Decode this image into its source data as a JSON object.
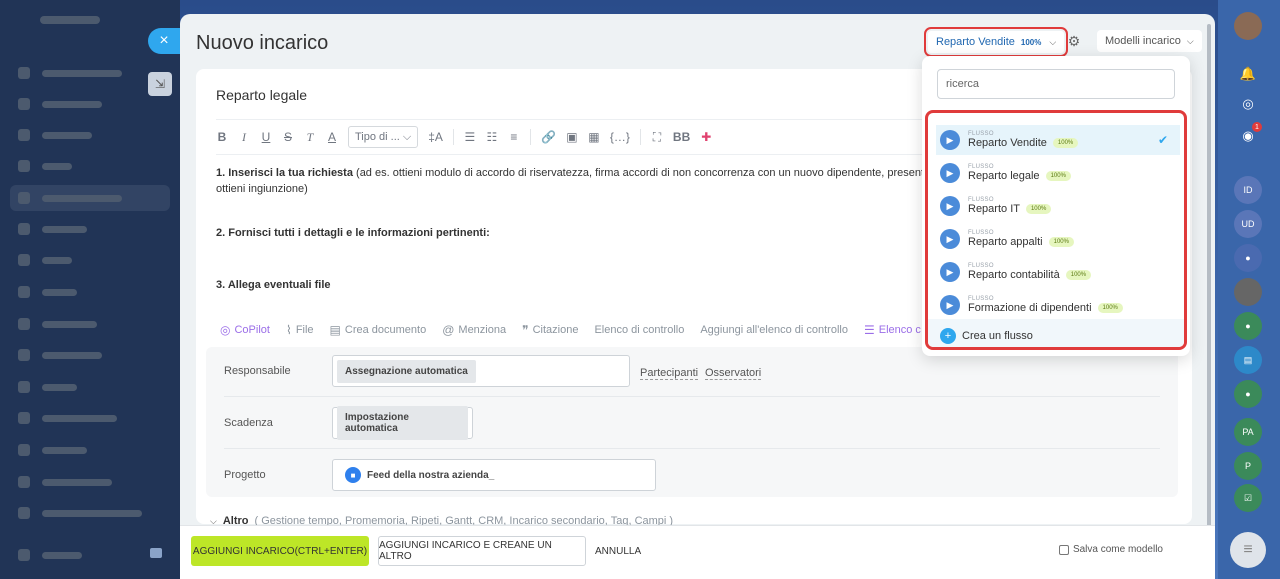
{
  "modal": {
    "title": "Nuovo incarico",
    "flow_selector": {
      "label": "Reparto Vendite",
      "percent": "100%"
    },
    "templates_button": "Modelli incarico"
  },
  "editor": {
    "task_title": "Reparto legale",
    "toolbar": {
      "bold": "B",
      "italic": "I",
      "underline": "U",
      "strike": "S",
      "clear": "T",
      "color": "A",
      "style_select": "Tipo di ...",
      "font_size": "‡A",
      "code_block": "{…}",
      "bbcode": "BB"
    },
    "content": {
      "item1_bold": "1. Inserisci la tua richiesta",
      "item1_rest": " (ad es. ottieni modulo di accordo di riservatezza, firma accordi di non concorrenza con un nuovo dipendente, presenta un",
      "item1_line2": "ottieni ingiunzione)",
      "item2_bold": "2. Fornisci tutti i dettagli e le informazioni pertinenti:",
      "item3_bold": "3. Allega eventuali file"
    },
    "actions": {
      "copilot": "CoPilot",
      "file": "File",
      "document": "Crea documento",
      "mention": "Menziona",
      "quote": "Citazione",
      "checklist": "Elenco di controllo",
      "add_checklist": "Aggiungi all'elenco di controllo",
      "checklist_short": "Elenco c"
    }
  },
  "fields": {
    "responsible": {
      "label": "Responsabile",
      "value": "Assegnazione automatica",
      "participants": "Partecipanti",
      "observers": "Osservatori"
    },
    "deadline": {
      "label": "Scadenza",
      "value": "Impostazione automatica"
    },
    "project": {
      "label": "Progetto",
      "value": "Feed della nostra azienda_"
    }
  },
  "altro": {
    "label": "Altro",
    "items": "( Gestione tempo,  Promemoria,  Ripeti,  Gantt,  CRM,  Incarico secondario,  Tag,  Campi )"
  },
  "footer": {
    "primary": "AGGIUNGI INCARICO(CTRL+ENTER)",
    "secondary": "AGGIUNGI INCARICO E CREANE UN ALTRO",
    "cancel": "ANNULLA",
    "save_template": "Salva come modello"
  },
  "popup": {
    "search_placeholder": "ricerca",
    "kind_label": "FLUSSO",
    "flows": [
      {
        "name": "Reparto Vendite",
        "badge": "100%"
      },
      {
        "name": "Reparto legale",
        "badge": "100%"
      },
      {
        "name": "Reparto IT",
        "badge": "100%"
      },
      {
        "name": "Reparto appalti",
        "badge": "100%"
      },
      {
        "name": "Reparto contabilità",
        "badge": "100%"
      },
      {
        "name": "Formazione di dipendenti",
        "badge": "100%"
      }
    ],
    "create": "Crea un flusso"
  },
  "right_sidebar": {
    "badge_count": "1",
    "initials": [
      "ID",
      "UD",
      "PA",
      "P"
    ]
  },
  "colors": {
    "accent": "#2fa7ee",
    "primary_button": "#bde627",
    "highlight": "#e03b3b"
  }
}
